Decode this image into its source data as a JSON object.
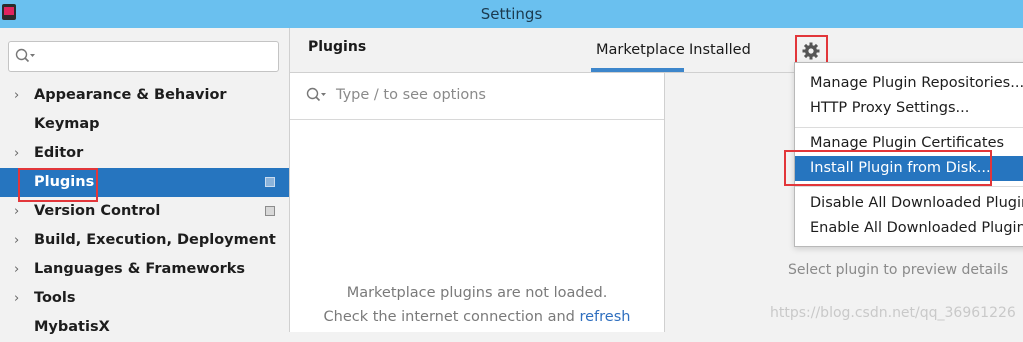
{
  "window": {
    "title": "Settings"
  },
  "sidebar": {
    "search": {
      "placeholder": ""
    },
    "items": [
      {
        "label": "Appearance & Behavior",
        "expandable": true
      },
      {
        "label": "Keymap",
        "expandable": false
      },
      {
        "label": "Editor",
        "expandable": true
      },
      {
        "label": "Plugins",
        "expandable": false,
        "selected": true
      },
      {
        "label": "Version Control",
        "expandable": true
      },
      {
        "label": "Build, Execution, Deployment",
        "expandable": true
      },
      {
        "label": "Languages & Frameworks",
        "expandable": true
      },
      {
        "label": "Tools",
        "expandable": true
      },
      {
        "label": "MybatisX",
        "expandable": false
      }
    ]
  },
  "header": {
    "title": "Plugins",
    "tabs": [
      {
        "label": "Marketplace",
        "active": true
      },
      {
        "label": "Installed",
        "active": false
      }
    ]
  },
  "options_search": {
    "placeholder": "Type / to see options"
  },
  "marketplace": {
    "message_line1": "Marketplace plugins are not loaded.",
    "message_line2": "Check the internet connection and ",
    "refresh_link": "refresh"
  },
  "preview": {
    "message": "Select plugin to preview details"
  },
  "gear_menu": {
    "items": [
      {
        "label": "Manage Plugin Repositories..."
      },
      {
        "label": "HTTP Proxy Settings..."
      },
      {
        "label": "Manage Plugin Certificates"
      },
      {
        "label": "Install Plugin from Disk...",
        "highlighted": true
      },
      {
        "label": "Disable All Downloaded Plugins"
      },
      {
        "label": "Enable All Downloaded Plugins"
      }
    ]
  },
  "watermark": "https://blog.csdn.net/qq_36961226",
  "colors": {
    "accent": "#2675bf",
    "titlebar": "#6ac0ef",
    "highlight_box": "#e2363a"
  }
}
